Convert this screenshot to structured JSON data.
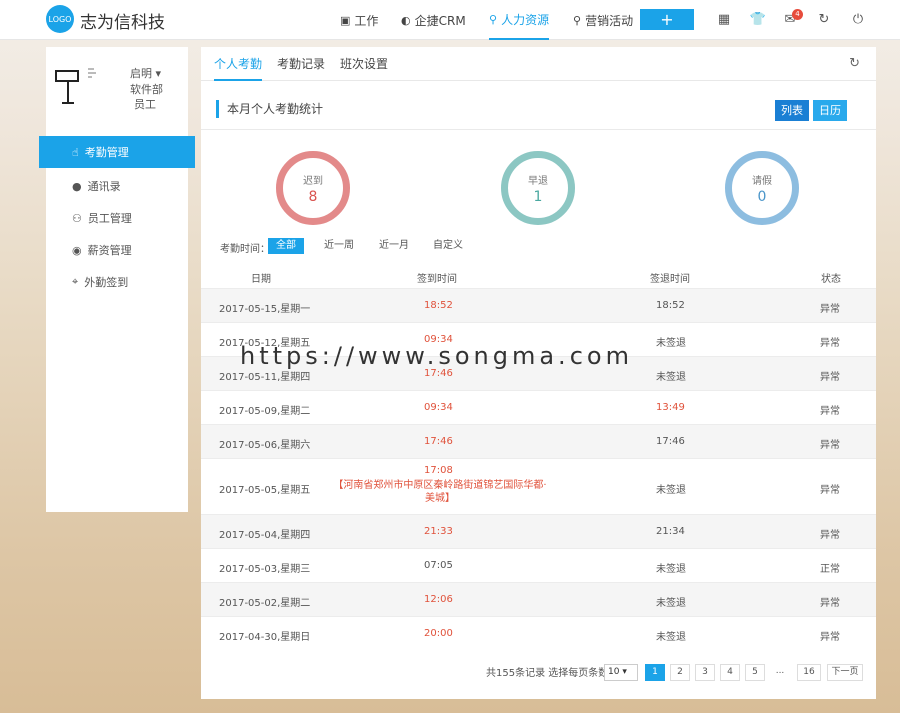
{
  "header": {
    "logo_text": "LOGO",
    "brand": "志为信科技",
    "nav": [
      {
        "label": "工作",
        "icon": "briefcase-icon"
      },
      {
        "label": "企捷CRM",
        "icon": "crm-icon"
      },
      {
        "label": "人力资源",
        "icon": "people-icon",
        "active": true
      },
      {
        "label": "营销活动",
        "icon": "marketing-icon"
      }
    ],
    "add_label": "+",
    "mail_badge": "4"
  },
  "sidebar": {
    "user_name": "启明 ▾",
    "user_dept": "软件部",
    "user_role": "员工",
    "items": [
      {
        "label": "考勤管理",
        "icon": "hand-icon",
        "active": true
      },
      {
        "label": "通讯录",
        "icon": "contact-icon"
      },
      {
        "label": "员工管理",
        "icon": "staff-icon"
      },
      {
        "label": "薪资管理",
        "icon": "salary-icon"
      },
      {
        "label": "外勤签到",
        "icon": "location-icon"
      }
    ]
  },
  "tabs": [
    "个人考勤",
    "考勤记录",
    "班次设置"
  ],
  "section_title": "本月个人考勤统计",
  "view_buttons": {
    "list": "列表",
    "calendar": "日历"
  },
  "stats": [
    {
      "label": "迟到",
      "value": "8",
      "color": "#e38a8a",
      "text_color": "#d9534f"
    },
    {
      "label": "早退",
      "value": "1",
      "color": "#8cc7c3",
      "text_color": "#4aa8a0"
    },
    {
      "label": "请假",
      "value": "0",
      "color": "#8dbde0",
      "text_color": "#4a95c9"
    }
  ],
  "filter": {
    "label": "考勤时间：",
    "options": [
      "全部",
      "近一周",
      "近一月",
      "自定义"
    ]
  },
  "table": {
    "headers": [
      "日期",
      "签到时间",
      "签退时间",
      "状态"
    ],
    "rows": [
      {
        "date": "2017-05-15,星期一",
        "in": "18:52",
        "in_red": true,
        "out": "18:52",
        "out_red": false,
        "status": "异常"
      },
      {
        "date": "2017-05-12,星期五",
        "in": "09:34",
        "in_red": true,
        "out": "未签退",
        "out_red": false,
        "status": "异常"
      },
      {
        "date": "2017-05-11,星期四",
        "in": "17:46",
        "in_red": true,
        "out": "未签退",
        "out_red": false,
        "status": "异常"
      },
      {
        "date": "2017-05-09,星期二",
        "in": "09:34",
        "in_red": true,
        "out": "13:49",
        "out_red": true,
        "status": "异常"
      },
      {
        "date": "2017-05-06,星期六",
        "in": "17:46",
        "in_red": true,
        "out": "17:46",
        "out_red": false,
        "status": "异常"
      },
      {
        "date": "2017-05-05,星期五",
        "in": "17:08",
        "in_red": true,
        "in_addr": "【河南省郑州市中原区秦岭路街道锦艺国际华都·美城】",
        "out": "未签退",
        "out_red": false,
        "status": "异常"
      },
      {
        "date": "2017-05-04,星期四",
        "in": "21:33",
        "in_red": true,
        "out": "21:34",
        "out_red": false,
        "status": "异常"
      },
      {
        "date": "2017-05-03,星期三",
        "in": "07:05",
        "in_red": false,
        "out": "未签退",
        "out_red": false,
        "status": "正常"
      },
      {
        "date": "2017-05-02,星期二",
        "in": "12:06",
        "in_red": true,
        "out": "未签退",
        "out_red": false,
        "status": "异常"
      },
      {
        "date": "2017-04-30,星期日",
        "in": "20:00",
        "in_red": true,
        "out": "未签退",
        "out_red": false,
        "status": "异常"
      }
    ]
  },
  "pagination": {
    "summary": "共155条记录 选择每页条数",
    "page_size": "10",
    "pages": [
      "1",
      "2",
      "3",
      "4",
      "5",
      "...",
      "16"
    ],
    "next": "下一页"
  },
  "watermark": "https://www.songma.com"
}
